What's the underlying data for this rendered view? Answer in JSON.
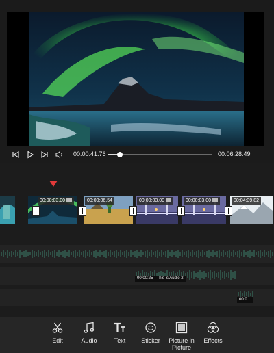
{
  "player": {
    "current_time": "00:00:41.76",
    "total_time": "00:06:28.49",
    "progress": 0.12,
    "buttons": [
      "previous-frame",
      "play",
      "next-frame",
      "volume"
    ]
  },
  "timeline": {
    "clips": [
      {
        "label": "00:00:03.00",
        "thumb": "aurora"
      },
      {
        "label": "00:00:06.54",
        "thumb": "desert"
      },
      {
        "label": "00:00:03.00",
        "thumb": "bridge"
      },
      {
        "label": "00:00:03.00",
        "thumb": "bridge"
      },
      {
        "label": "00:04:39.82",
        "thumb": "snow"
      }
    ],
    "audio_tracks": [
      {
        "label": "00:00:25 - This is Audio 2"
      },
      {
        "label": "00:0..."
      }
    ]
  },
  "toolbar": {
    "edit": "Edit",
    "audio": "Audio",
    "text": "Text",
    "sticker": "Sticker",
    "pip": "Picture in Picture",
    "effects": "Effects"
  },
  "colors": {
    "playhead": "#e23a3a",
    "toolbar_bg": "#262626",
    "timeline_bg": "#1c1c1c"
  }
}
